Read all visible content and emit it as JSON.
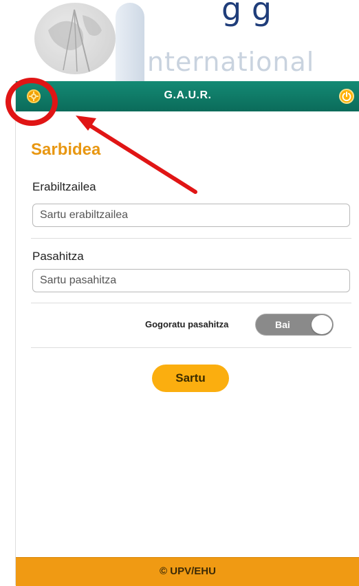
{
  "background": {
    "title_fragment": "g    g",
    "logo_text": "nternational"
  },
  "header": {
    "title": "G.A.U.R.",
    "settings_icon": "gear-icon",
    "power_icon": "power-icon",
    "accent_color": "#0f7a66"
  },
  "login": {
    "page_title": "Sarbidea",
    "username_label": "Erabiltzailea",
    "username_placeholder": "Sartu erabiltzailea",
    "password_label": "Pasahitza",
    "password_placeholder": "Sartu pasahitza",
    "remember_label": "Gogoratu pasahitza",
    "remember_toggle_text": "Bai",
    "remember_toggle_on": true,
    "submit_label": "Sartu",
    "title_color": "#e89712",
    "button_color": "#fbae0f"
  },
  "footer": {
    "text": "© UPV/EHU",
    "color": "#f09a13"
  },
  "annotation": {
    "color": "#e01515",
    "highlight": "settings-button"
  }
}
